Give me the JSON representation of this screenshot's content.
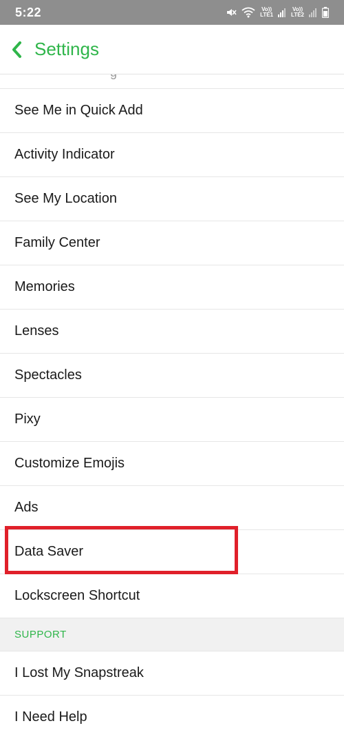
{
  "status_bar": {
    "time": "5:22",
    "sim1_label_top": "Vo))",
    "sim1_label_bottom": "LTE1",
    "sim2_label_top": "Vo))",
    "sim2_label_bottom": "LTE2"
  },
  "header": {
    "title": "Settings",
    "accent_color": "#2fb54a"
  },
  "list": {
    "items_before": [
      "See Me in Quick Add",
      "Activity Indicator",
      "See My Location",
      "Family Center",
      "Memories",
      "Lenses",
      "Spectacles",
      "Pixy",
      "Customize Emojis",
      "Ads",
      "Data Saver",
      "Lockscreen Shortcut"
    ],
    "section_support": "SUPPORT",
    "items_support": [
      "I Lost My Snapstreak",
      "I Need Help"
    ]
  },
  "annotation": {
    "highlight_color": "#e0202a",
    "highlighted_item": "Data Saver"
  }
}
